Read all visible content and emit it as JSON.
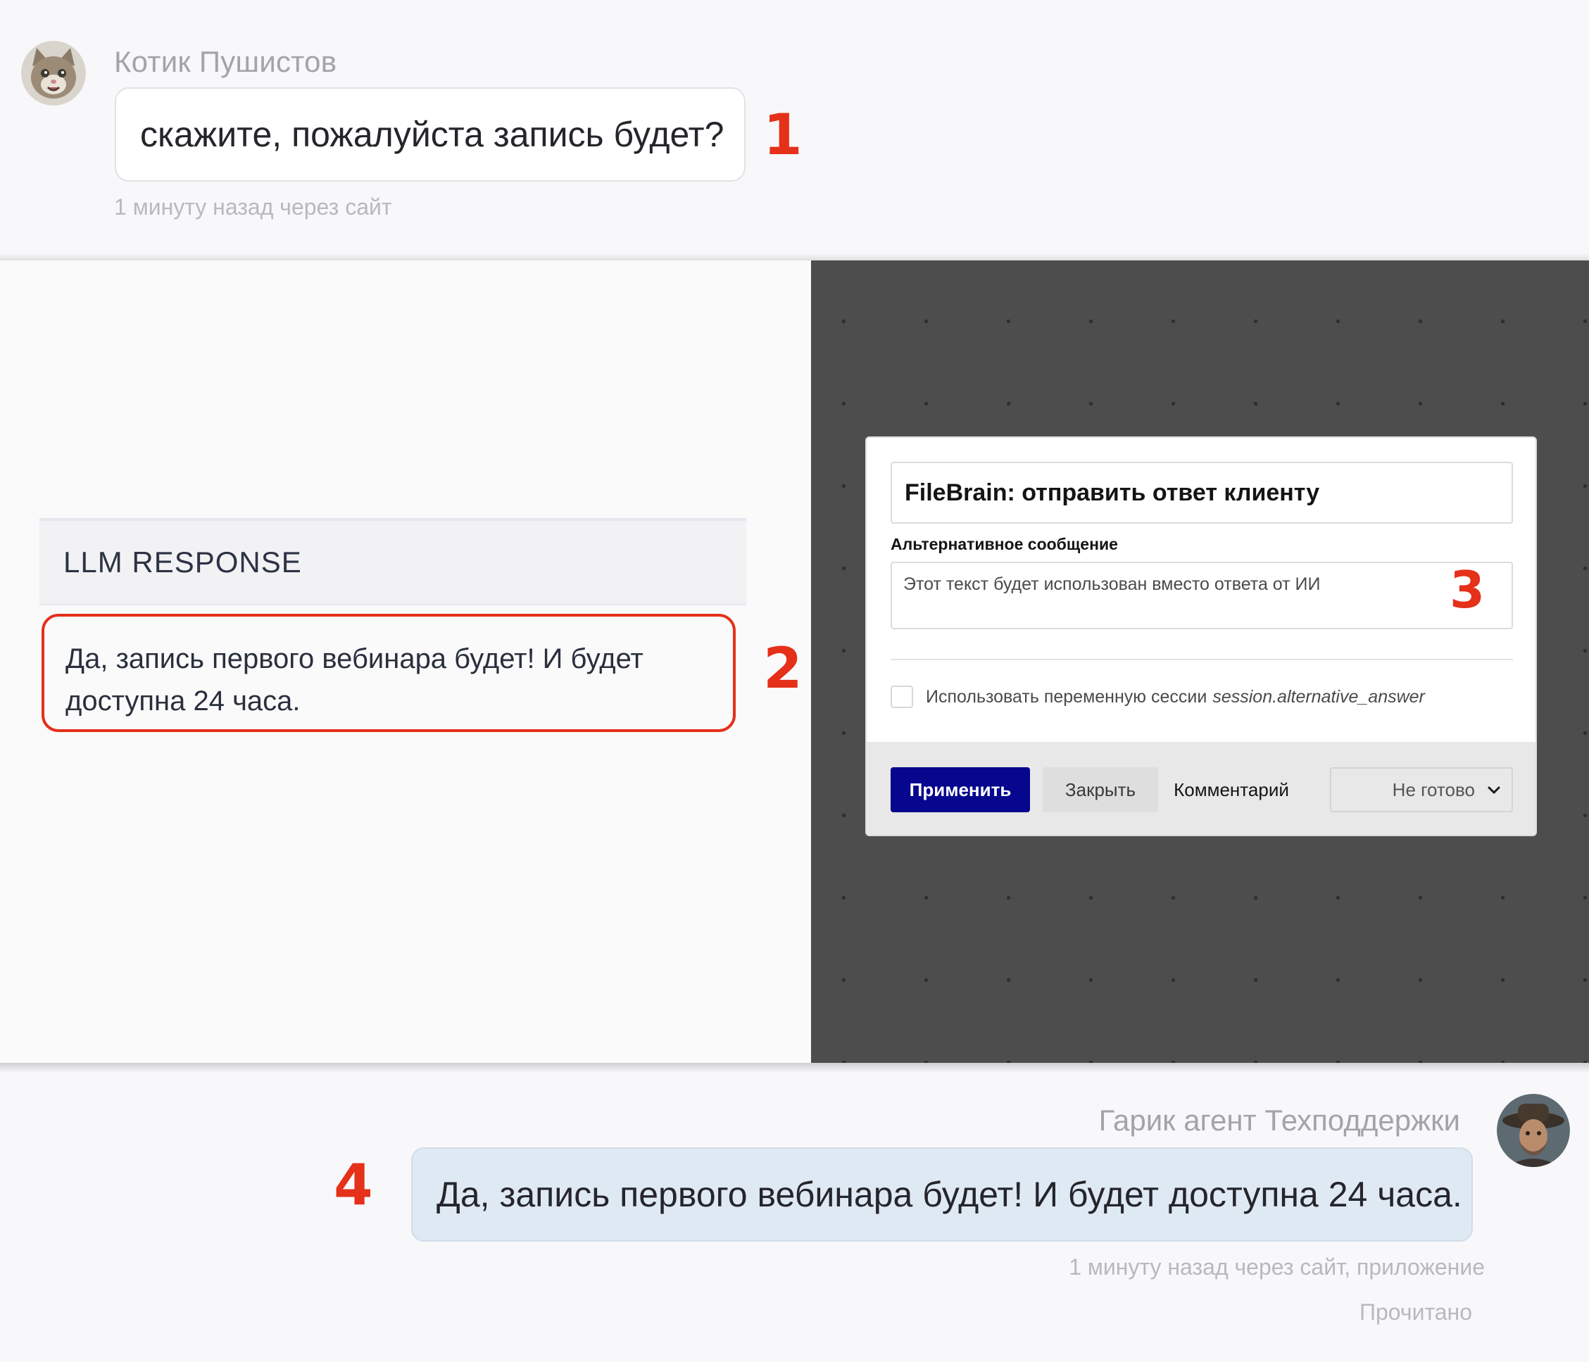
{
  "client_message": {
    "author": "Котик Пушистов",
    "text": "скажите, пожалуйста запись будет?",
    "meta": "1 минуту назад через сайт",
    "avatar_icon": "cat-avatar-icon"
  },
  "llm_panel": {
    "header": "LLM RESPONSE",
    "response": "Да, запись первого вебинара будет! И будет доступна 24 часа."
  },
  "dialog": {
    "title": "FileBrain: отправить ответ клиенту",
    "alt_label": "Альтернативное сообщение",
    "alt_placeholder": "Этот текст будет использован вместо ответа от ИИ",
    "alt_value": "",
    "checkbox_label": "Использовать переменную сессии",
    "checkbox_variable": "session.alternative_answer",
    "checkbox_checked": false,
    "apply_label": "Применить",
    "close_label": "Закрыть",
    "comment_label": "Комментарий",
    "status_value": "Не готово",
    "accent_color": "#06068f"
  },
  "agent_message": {
    "author": "Гарик агент Техподдержки",
    "text": "Да, запись первого вебинара будет! И будет доступна 24 часа.",
    "meta": "1 минуту назад через сайт, приложение",
    "read_status": "Прочитано",
    "avatar_icon": "agent-avatar-icon"
  },
  "markers": {
    "m1": "1",
    "m2": "2",
    "m3": "3",
    "m4": "4",
    "color": "#e5301a"
  }
}
